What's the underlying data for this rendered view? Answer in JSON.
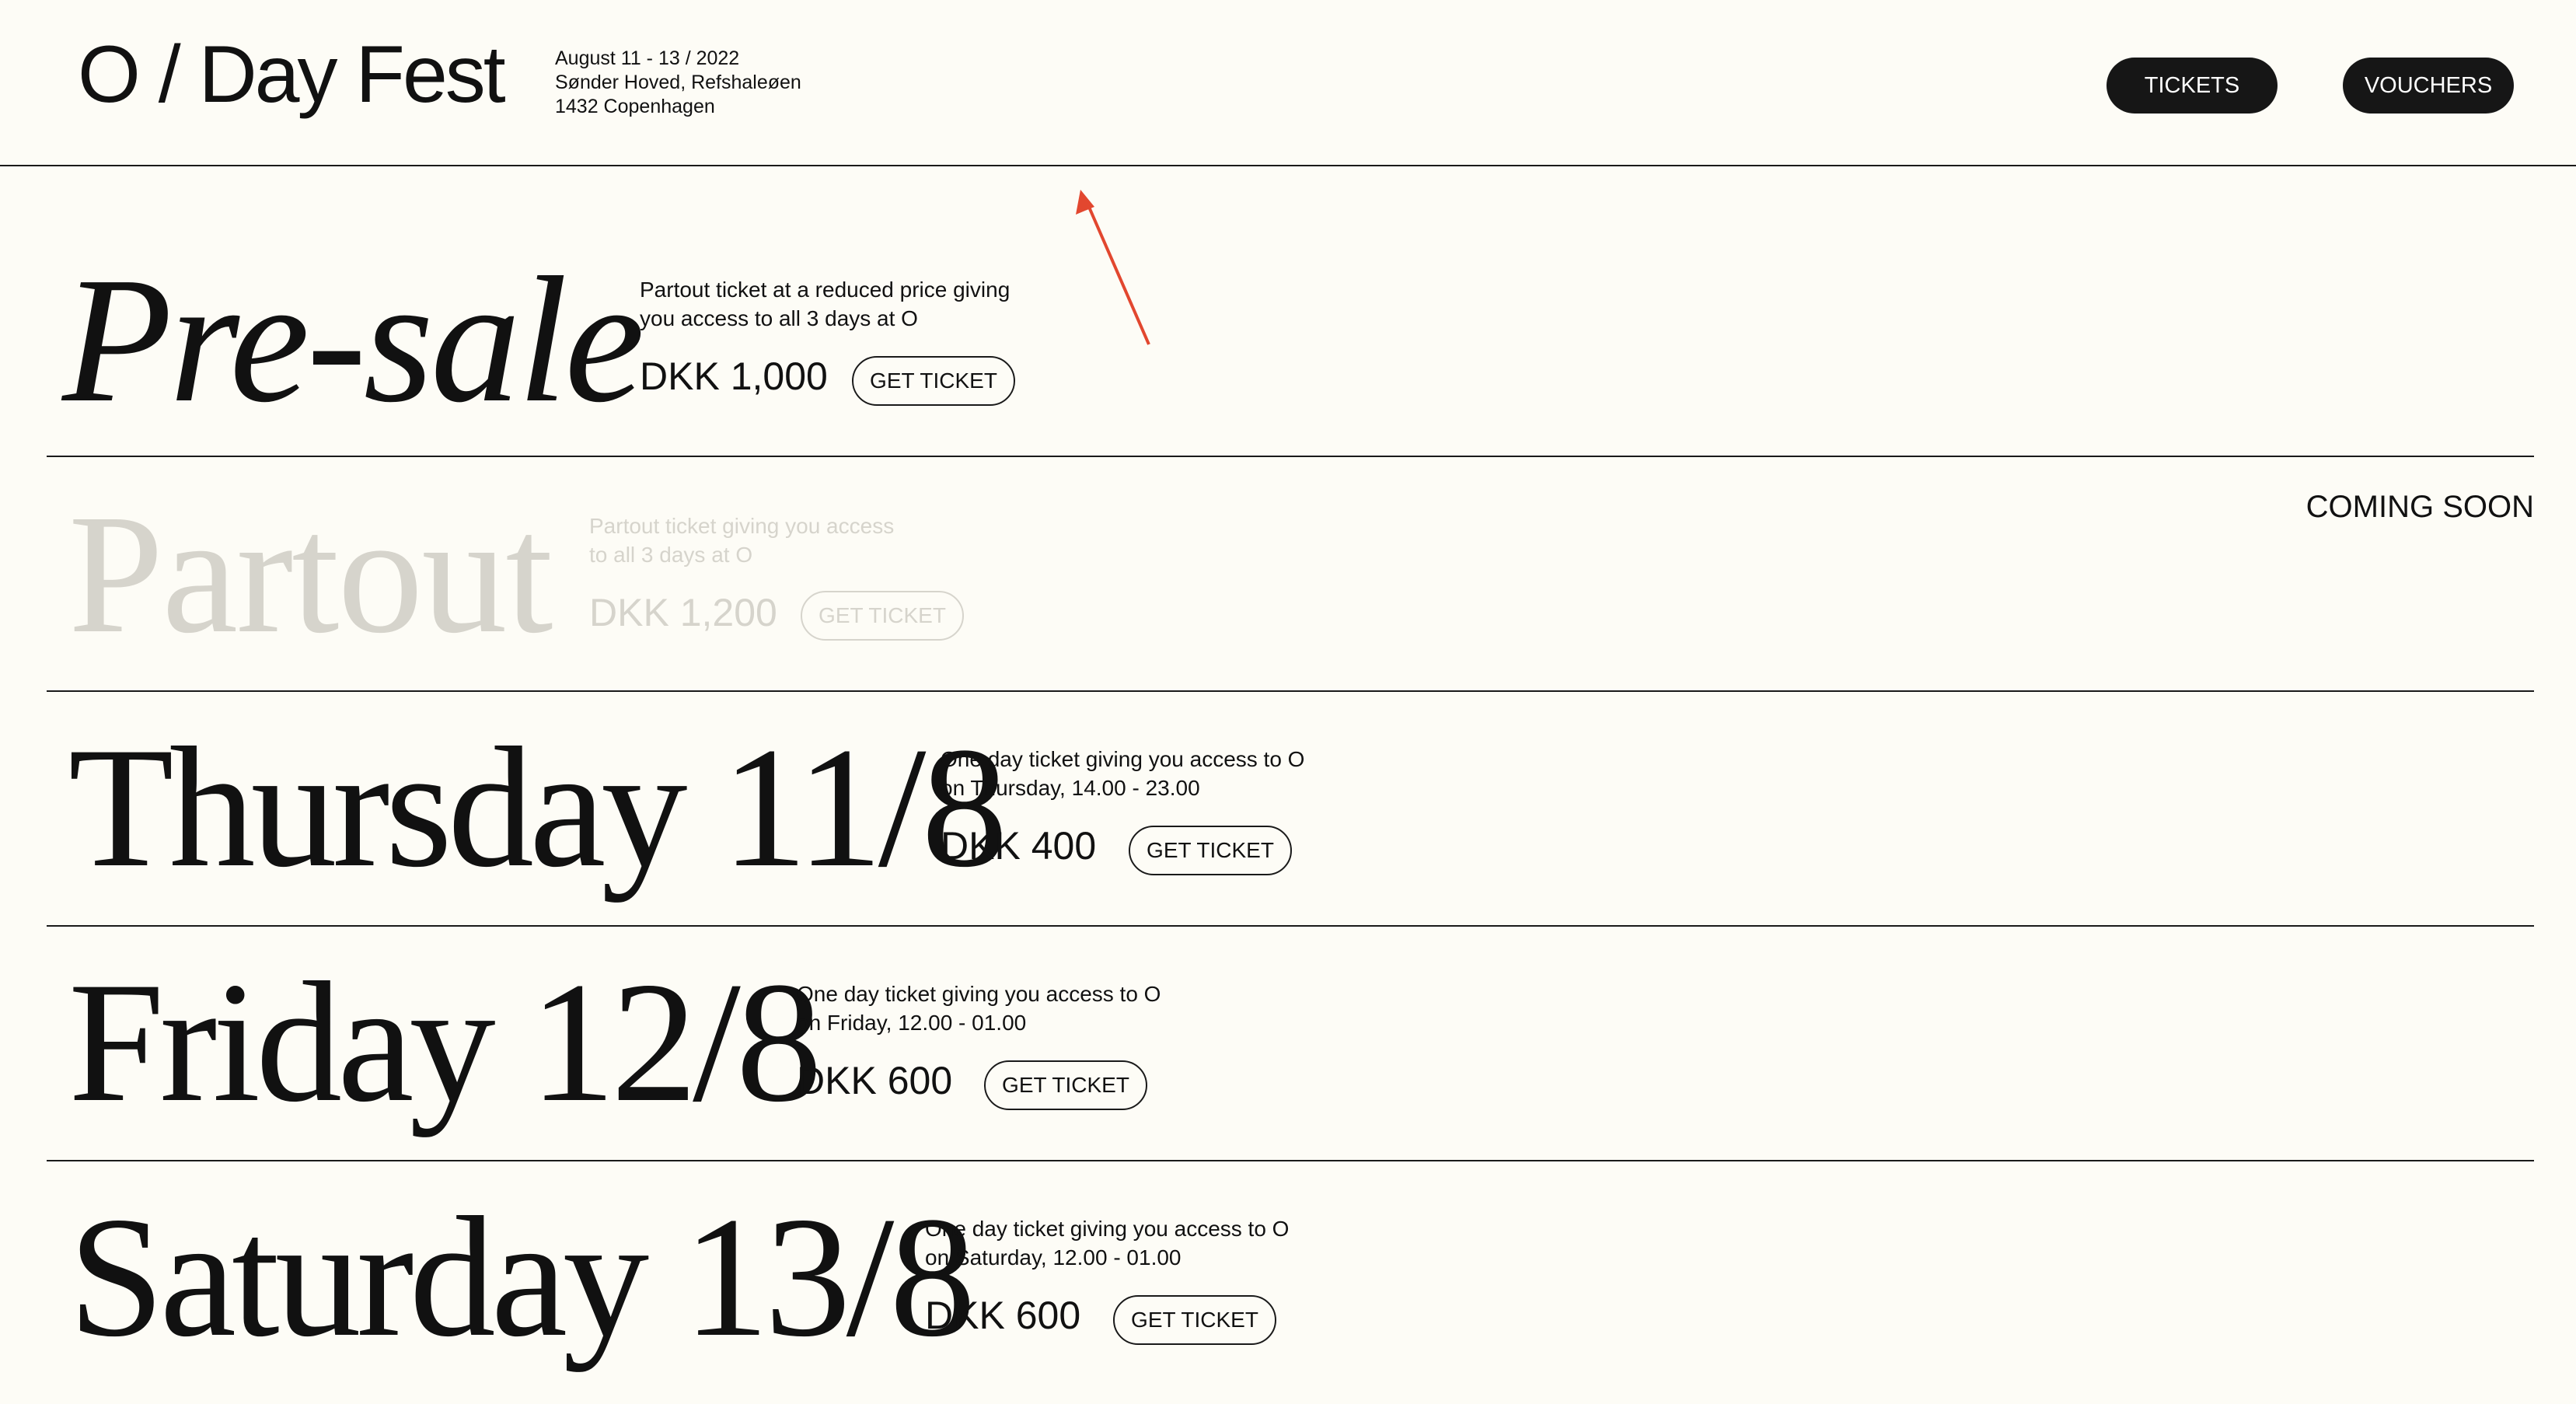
{
  "header": {
    "logo": "O / Day Fest",
    "date": "August 11 - 13 / 2022",
    "address_line1": "Sønder Hoved, Refshaleøen",
    "address_line2": "1432 Copenhagen",
    "nav": {
      "tickets": "TICKETS",
      "vouchers": "VOUCHERS"
    }
  },
  "tickets": [
    {
      "title": "Pre-sale",
      "desc_line1": "Partout ticket at a reduced price giving",
      "desc_line2": "you access to all 3 days at O",
      "price": "DKK 1,000",
      "button": "GET TICKET"
    },
    {
      "title": "Partout",
      "desc_line1": "Partout ticket giving you access",
      "desc_line2": "to all 3 days at O",
      "price": "DKK 1,200",
      "button": "GET TICKET",
      "status": "COMING SOON"
    },
    {
      "title": "Thursday 11/8",
      "desc_line1": "One day ticket giving you access to O",
      "desc_line2": "on Thursday, 14.00 - 23.00",
      "price": "DKK 400",
      "button": "GET TICKET"
    },
    {
      "title": "Friday 12/8",
      "desc_line1": "One day ticket giving you access to O",
      "desc_line2": "on Friday, 12.00 - 01.00",
      "price": "DKK 600",
      "button": "GET TICKET"
    },
    {
      "title": "Saturday 13/8",
      "desc_line1": "One day ticket giving you access to O",
      "desc_line2": "on Saturday, 12.00 - 01.00",
      "price": "DKK 600",
      "button": "GET TICKET"
    }
  ],
  "colors": {
    "background": "#fdfcf6",
    "text": "#111111",
    "disabled_text": "#d6d4cc",
    "annotation_arrow": "#e2472f"
  }
}
